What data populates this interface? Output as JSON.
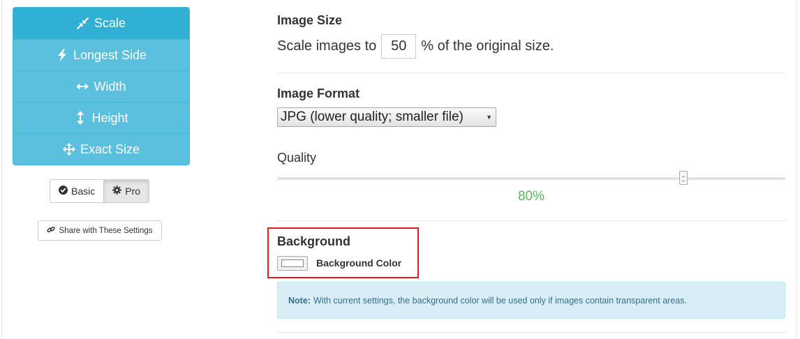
{
  "resize_modes": [
    {
      "label": "Scale",
      "icon": "compress-arrows-icon",
      "active": true
    },
    {
      "label": "Longest Side",
      "icon": "bolt-icon",
      "active": false
    },
    {
      "label": "Width",
      "icon": "horizontal-arrows-icon",
      "active": false
    },
    {
      "label": "Height",
      "icon": "vertical-arrows-icon",
      "active": false
    },
    {
      "label": "Exact Size",
      "icon": "move-arrows-icon",
      "active": false
    }
  ],
  "mode_toggle": {
    "basic_label": "Basic",
    "pro_label": "Pro",
    "active": "Pro"
  },
  "share_button": {
    "label": "Share with These Settings"
  },
  "image_size": {
    "title": "Image Size",
    "prefix": "Scale images to",
    "value": "50",
    "suffix": "% of the original size."
  },
  "image_format": {
    "title": "Image Format",
    "selected": "JPG (lower quality; smaller file)"
  },
  "quality": {
    "title": "Quality",
    "value": 80,
    "display": "80%"
  },
  "background": {
    "title": "Background",
    "color_label": "Background Color",
    "color": "#ffffff"
  },
  "note": {
    "prefix": "Note:",
    "text": "With current settings, the background color will be used only if images contain transparent areas."
  }
}
